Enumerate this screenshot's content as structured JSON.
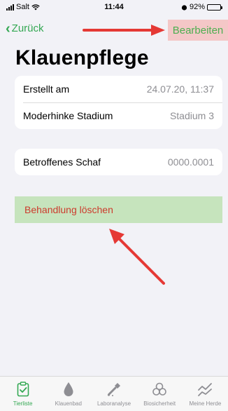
{
  "status_bar": {
    "carrier": "Salt",
    "time": "11:44",
    "battery": "92%",
    "battery_level": 0.92
  },
  "nav": {
    "back_label": "Zurück",
    "edit_label": "Bearbeiten"
  },
  "page": {
    "title": "Klauenpflege"
  },
  "details": [
    {
      "label": "Erstellt am",
      "value": "24.07.20, 11:37"
    },
    {
      "label": "Moderhinke Stadium",
      "value": "Stadium 3"
    }
  ],
  "affected": {
    "label": "Betroffenes Schaf",
    "value": "0000.0001"
  },
  "delete_label": "Behandlung löschen",
  "colors": {
    "accent": "#34a853",
    "destructive": "#cc3b2d",
    "arrow": "#e53935",
    "highlight_red": "#f4c7c7",
    "highlight_green": "#c6e4bd"
  },
  "tabbar": {
    "active": "Tierliste",
    "tabs": [
      {
        "label": "Tierliste",
        "icon": "clipboard-check-icon"
      },
      {
        "label": "Klauenbad",
        "icon": "drop-icon"
      },
      {
        "label": "Laboranalyse",
        "icon": "pipette-icon"
      },
      {
        "label": "Biosicherheit",
        "icon": "biohazard-icon"
      },
      {
        "label": "Meine Herde",
        "icon": "trend-icon"
      }
    ]
  }
}
